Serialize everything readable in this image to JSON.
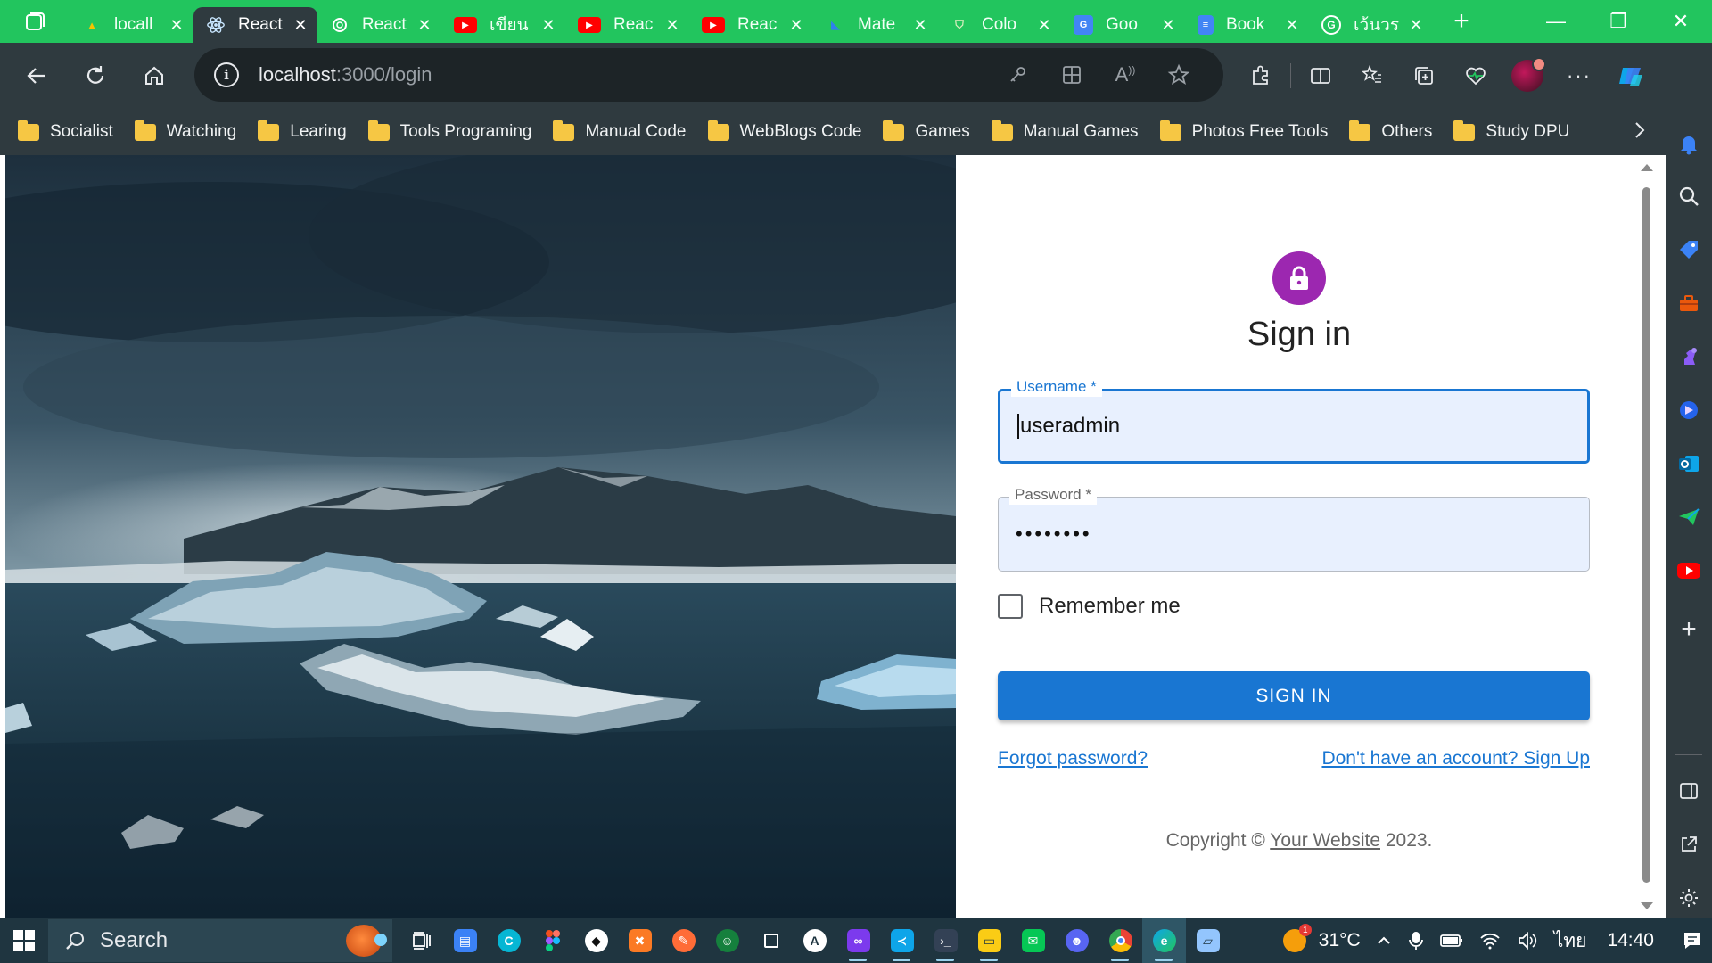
{
  "browser": {
    "tabs": [
      {
        "title": "locall",
        "favicon": "logo-tab-icon",
        "active": false
      },
      {
        "title": "React",
        "favicon": "react-icon",
        "active": true
      },
      {
        "title": "React",
        "favicon": "openai-icon",
        "active": false
      },
      {
        "title": "เขียน",
        "favicon": "youtube-icon",
        "active": false
      },
      {
        "title": "Reac",
        "favicon": "youtube-icon",
        "active": false
      },
      {
        "title": "Reac",
        "favicon": "youtube-icon",
        "active": false
      },
      {
        "title": "Mate",
        "favicon": "material-ui-icon",
        "active": false
      },
      {
        "title": "Colo",
        "favicon": "shield-icon",
        "active": false
      },
      {
        "title": "Goo",
        "favicon": "google-translate-icon",
        "active": false
      },
      {
        "title": "Book",
        "favicon": "docs-icon",
        "active": false
      },
      {
        "title": "เว้นวร",
        "favicon": "grammarly-icon",
        "active": false
      }
    ],
    "address": {
      "host": "localhost",
      "rest": ":3000/login"
    },
    "bookmarks": [
      "Socialist",
      "Watching",
      "Learing",
      "Tools Programing",
      "Manual Code",
      "WebBlogs Code",
      "Games",
      "Manual Games",
      "Photos Free Tools",
      "Others",
      "Study DPU"
    ]
  },
  "login": {
    "heading": "Sign in",
    "username_label": "Username *",
    "username_value": "useradmin",
    "password_label": "Password *",
    "password_value": "••••••••",
    "remember_label": "Remember me",
    "remember_checked": false,
    "submit_label": "SIGN IN",
    "forgot_link": "Forgot password?",
    "signup_link": "Don't have an account? Sign Up",
    "copyright_prefix": "Copyright © ",
    "copyright_site": "Your Website",
    "copyright_suffix": " 2023."
  },
  "taskbar": {
    "search_placeholder": "Search",
    "temperature": "31°C",
    "language": "ไทย",
    "time": "14:40",
    "weather_badge": "1"
  },
  "colors": {
    "tab_strip": "#22c55e",
    "toolbar": "#2f3a3f",
    "primary": "#1976d2",
    "avatar": "#9c27b0"
  }
}
